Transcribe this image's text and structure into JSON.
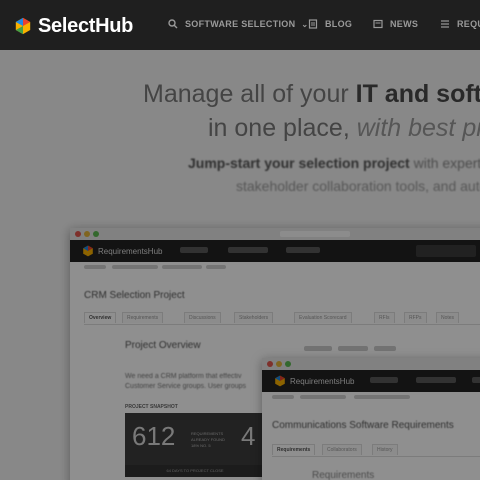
{
  "brand": {
    "name": "SelectHub"
  },
  "nav": {
    "items": [
      {
        "label": "SOFTWARE SELECTION",
        "icon": "search-icon",
        "has_dropdown": true
      },
      {
        "label": "BLOG",
        "icon": "document-icon"
      },
      {
        "label": "NEWS",
        "icon": "news-icon"
      },
      {
        "label": "REQU",
        "icon": "list-icon"
      }
    ]
  },
  "hero": {
    "line1_a": "Manage all of your ",
    "line1_b": "IT and softwa",
    "line2_a": "in one place, ",
    "line2_b": "with best prac",
    "sub1_a": "Jump-start your selection project",
    "sub1_b": " with expert c",
    "sub2": "stakeholder collaboration tools, and autom"
  },
  "screenshot1": {
    "app_name": "RequirementsHub",
    "project_title": "CRM Selection Project",
    "tabs": [
      "Overview",
      "Requirements",
      "Discussions",
      "Stakeholders",
      "Evaluation Scorecard",
      "RFIs",
      "RFPs",
      "Notes"
    ],
    "overview_title": "Project Overview",
    "description_lines": [
      "We need a CRM platform that effectiv",
      "Customer Service groups. User groups"
    ],
    "snapshot_label": "PROJECT SNAPSHOT",
    "snapshot_number": "612",
    "snapshot_sub": [
      "REQUIREMENTS",
      "ALREADY FOUND",
      "18% NO. 5"
    ],
    "snapshot_number2": "4",
    "snapshot_button": "64 DAYS TO PROJECT CLOSE"
  },
  "screenshot2": {
    "app_name": "RequirementsHub",
    "project_title": "Communications Software Requirements",
    "tabs": [
      "Requirements",
      "Collaborators",
      "History"
    ],
    "heading": "Requirements"
  },
  "colors": {
    "nav_bg": "#1b1b1b",
    "logo_red": "#e9412e",
    "logo_blue": "#1e88e5",
    "logo_yellow": "#f9b000",
    "logo_green": "#43a047"
  }
}
